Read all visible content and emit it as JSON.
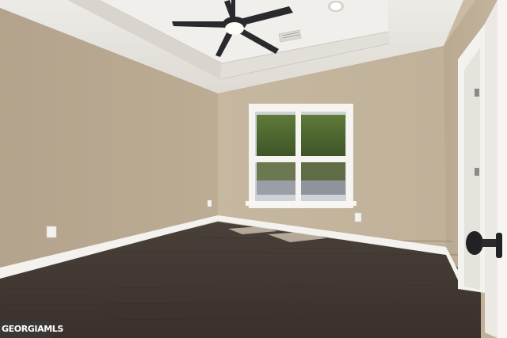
{
  "scene": {
    "description_tag": "empty-bedroom-photo",
    "elements": [
      "tray-ceiling",
      "ceiling-fan",
      "recessed-light",
      "air-vent",
      "double-hung-window",
      "door",
      "hardwood-floor",
      "baseboards",
      "outlets"
    ]
  },
  "watermark": {
    "text": "GEORGIAMLS"
  },
  "colors": {
    "wall_left": "#b8a890",
    "wall_back": "#c2b39b",
    "wall_right": "#bcac94",
    "ceiling": "#e9e6e0",
    "floor": "#3f3631",
    "trim": "#f4f2ee",
    "fan": "#2a2a2c"
  }
}
